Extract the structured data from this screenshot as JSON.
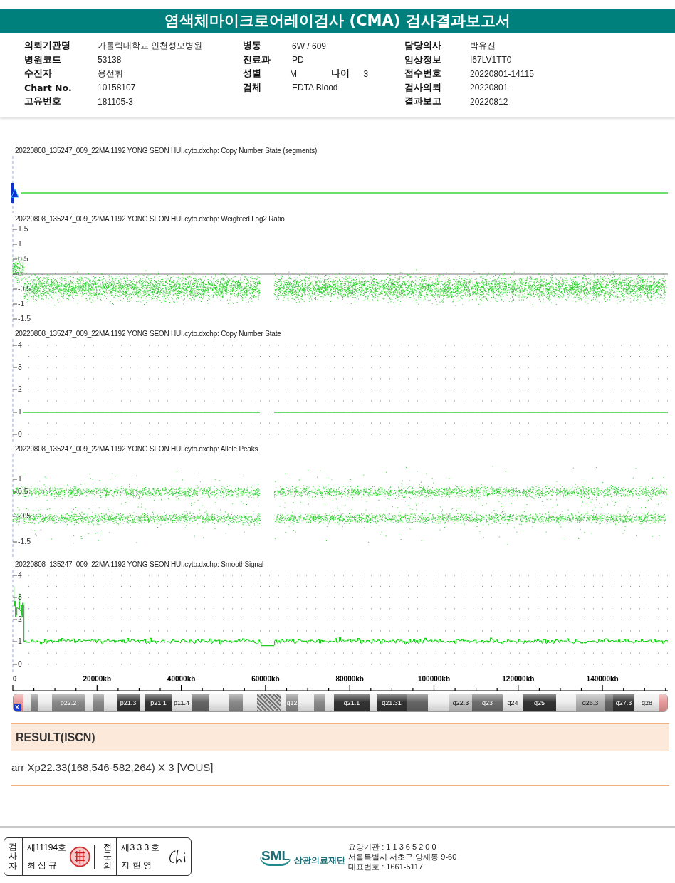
{
  "header": {
    "title": "염색체마이크로어레이검사 (CMA) 검사결과보고서"
  },
  "info_columns": [
    [
      {
        "label": "의뢰기관명",
        "value": "가톨릭대학교 인천성모병원"
      },
      {
        "label": "병원코드",
        "value": "53138"
      },
      {
        "label": "수진자",
        "value": "용선휘"
      },
      {
        "label": "Chart No.",
        "value": "10158107"
      },
      {
        "label": "고유번호",
        "value": "181105-3"
      }
    ],
    [
      {
        "label": "병동",
        "value": "6W / 609"
      },
      {
        "label": "진료과",
        "value": "PD"
      },
      {
        "label": "성별",
        "value": "M",
        "extra_label": "나이",
        "extra_value": "3"
      },
      {
        "label": "검체",
        "value": "EDTA Blood"
      }
    ],
    [
      {
        "label": "담당의사",
        "value": "박유진"
      },
      {
        "label": "임상정보",
        "value": "I67LV1TT0"
      },
      {
        "label": "접수번호",
        "value": "20220801-14115"
      },
      {
        "label": "검사의뢰",
        "value": "20220801"
      },
      {
        "label": "결과보고",
        "value": "20220812"
      }
    ]
  ],
  "panels": [
    {
      "kind": "segments",
      "title": "20220808_135247_009_22MA 1192 YONG SEON HUI.cyto.dxchp: Copy Number State (segments)"
    },
    {
      "kind": "log2",
      "title": "20220808_135247_009_22MA 1192 YONG SEON HUI.cyto.dxchp: Weighted Log2 Ratio",
      "ticks": [
        "1.5",
        "1",
        "0.5",
        "0",
        "-0.5",
        "-1",
        "-1.5"
      ]
    },
    {
      "kind": "cn",
      "title": "20220808_135247_009_22MA 1192 YONG SEON HUI.cyto.dxchp: Copy Number State",
      "ticks": [
        "4",
        "3",
        "2",
        "1",
        "0"
      ]
    },
    {
      "kind": "allele",
      "title": "20220808_135247_009_22MA 1192 YONG SEON HUI.cyto.dxchp: Allele Peaks",
      "ticks": [
        "1",
        "0.5",
        "-0.5",
        "-1.5"
      ]
    },
    {
      "kind": "smooth",
      "title": "20220808_135247_009_22MA 1192 YONG SEON HUI.cyto.dxchp: SmoothSignal",
      "ticks": [
        "4",
        "3",
        "2",
        "1",
        "0"
      ]
    }
  ],
  "x_axis": {
    "labels": [
      "0",
      "20000kb",
      "40000kb",
      "60000kb",
      "80000kb",
      "100000kb",
      "120000kb",
      "140000kb"
    ]
  },
  "ideogram": {
    "chromosome": "X",
    "bands": [
      {
        "color": "#e89a9a"
      },
      {
        "color": "#eeeeee"
      },
      {
        "color": "#8a8a8a"
      },
      {
        "color": "#eeeeee"
      },
      {
        "label": "p22.2",
        "color": "#8a8a8a"
      },
      {
        "color": "#eeeeee"
      },
      {
        "color": "#8a8a8a"
      },
      {
        "color": "#eeeeee"
      },
      {
        "label": "p21.3",
        "color": "#333333"
      },
      {
        "color": "#eeeeee"
      },
      {
        "label": "p21.1",
        "color": "#333333"
      },
      {
        "label": "p11.4",
        "color": "#eeeeee"
      },
      {
        "color": "#666666"
      },
      {
        "color": "#eeeeee"
      },
      {
        "color": "#8a8a8a"
      },
      {
        "color": "#eeeeee"
      },
      {
        "kind": "centromere"
      },
      {
        "color": "#eeeeee"
      },
      {
        "label": "q12",
        "color": "#8a8a8a"
      },
      {
        "color": "#eeeeee"
      },
      {
        "color": "#8a8a8a"
      },
      {
        "color": "#eeeeee"
      },
      {
        "label": "q21.1",
        "color": "#333333"
      },
      {
        "color": "#eeeeee"
      },
      {
        "label": "q21.31",
        "color": "#333333"
      },
      {
        "color": "#666666"
      },
      {
        "color": "#eeeeee"
      },
      {
        "label": "q22.3",
        "color": "#c4c4c4"
      },
      {
        "label": "q23",
        "color": "#6e6e6e"
      },
      {
        "label": "q24",
        "color": "#eeeeee"
      },
      {
        "label": "q25",
        "color": "#333333"
      },
      {
        "color": "#eeeeee"
      },
      {
        "label": "q26.3",
        "color": "#b0b0b0"
      },
      {
        "color": "#666666"
      },
      {
        "label": "q27.3",
        "color": "#333333"
      },
      {
        "label": "q28",
        "color": "#eeeeee"
      },
      {
        "color": "#e89a9a"
      }
    ]
  },
  "result": {
    "heading": "RESULT(ISCN)",
    "text": "arr Xp22.33(168,546-582,264) X 3 [VOUS]"
  },
  "footer": {
    "examiner": {
      "role": "검사자",
      "number": "제11194호",
      "name": "최 삼 규"
    },
    "specialist": {
      "role": "전문의",
      "number": "제3 3 3 호",
      "name": "지 현 영"
    },
    "logo": {
      "mark": "SML",
      "name": "삼광의료재단"
    },
    "address_lines": [
      "요양기관 : 1 1 3 6 5 2 0 0",
      "서울특별시 서초구 양재동 9-60",
      "대표번호 : 1661-5117"
    ]
  }
}
